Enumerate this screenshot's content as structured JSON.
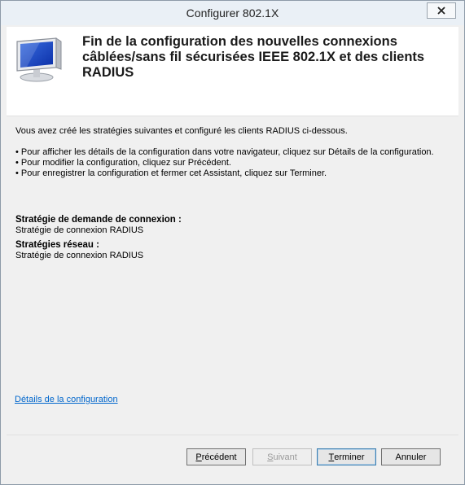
{
  "window": {
    "title": "Configurer 802.1X"
  },
  "header": {
    "title": "Fin de la configuration des nouvelles connexions câblées/sans fil sécurisées IEEE 802.1X et des clients RADIUS"
  },
  "content": {
    "intro": "Vous avez créé les stratégies suivantes et configuré les clients RADIUS ci-dessous.",
    "bullets": [
      "• Pour afficher les détails de la configuration dans votre navigateur, cliquez sur Détails de la configuration.",
      "• Pour modifier la configuration, cliquez sur Précédent.",
      "• Pour enregistrer la configuration et fermer cet Assistant, cliquez sur Terminer."
    ],
    "connection_request_policy_label": "Stratégie de demande de connexion :",
    "connection_request_policy_value": "Stratégie de connexion RADIUS",
    "network_policies_label": "Stratégies réseau :",
    "network_policies_value": "Stratégie de connexion RADIUS",
    "details_link": "Détails de la configuration"
  },
  "buttons": {
    "prev_accel": "P",
    "prev_rest": "récédent",
    "next_accel": "S",
    "next_rest": "uivant",
    "finish_accel": "T",
    "finish_rest": "erminer",
    "cancel": "Annuler"
  },
  "icons": {
    "close": "close-icon",
    "wizard": "monitor-network-icon"
  }
}
